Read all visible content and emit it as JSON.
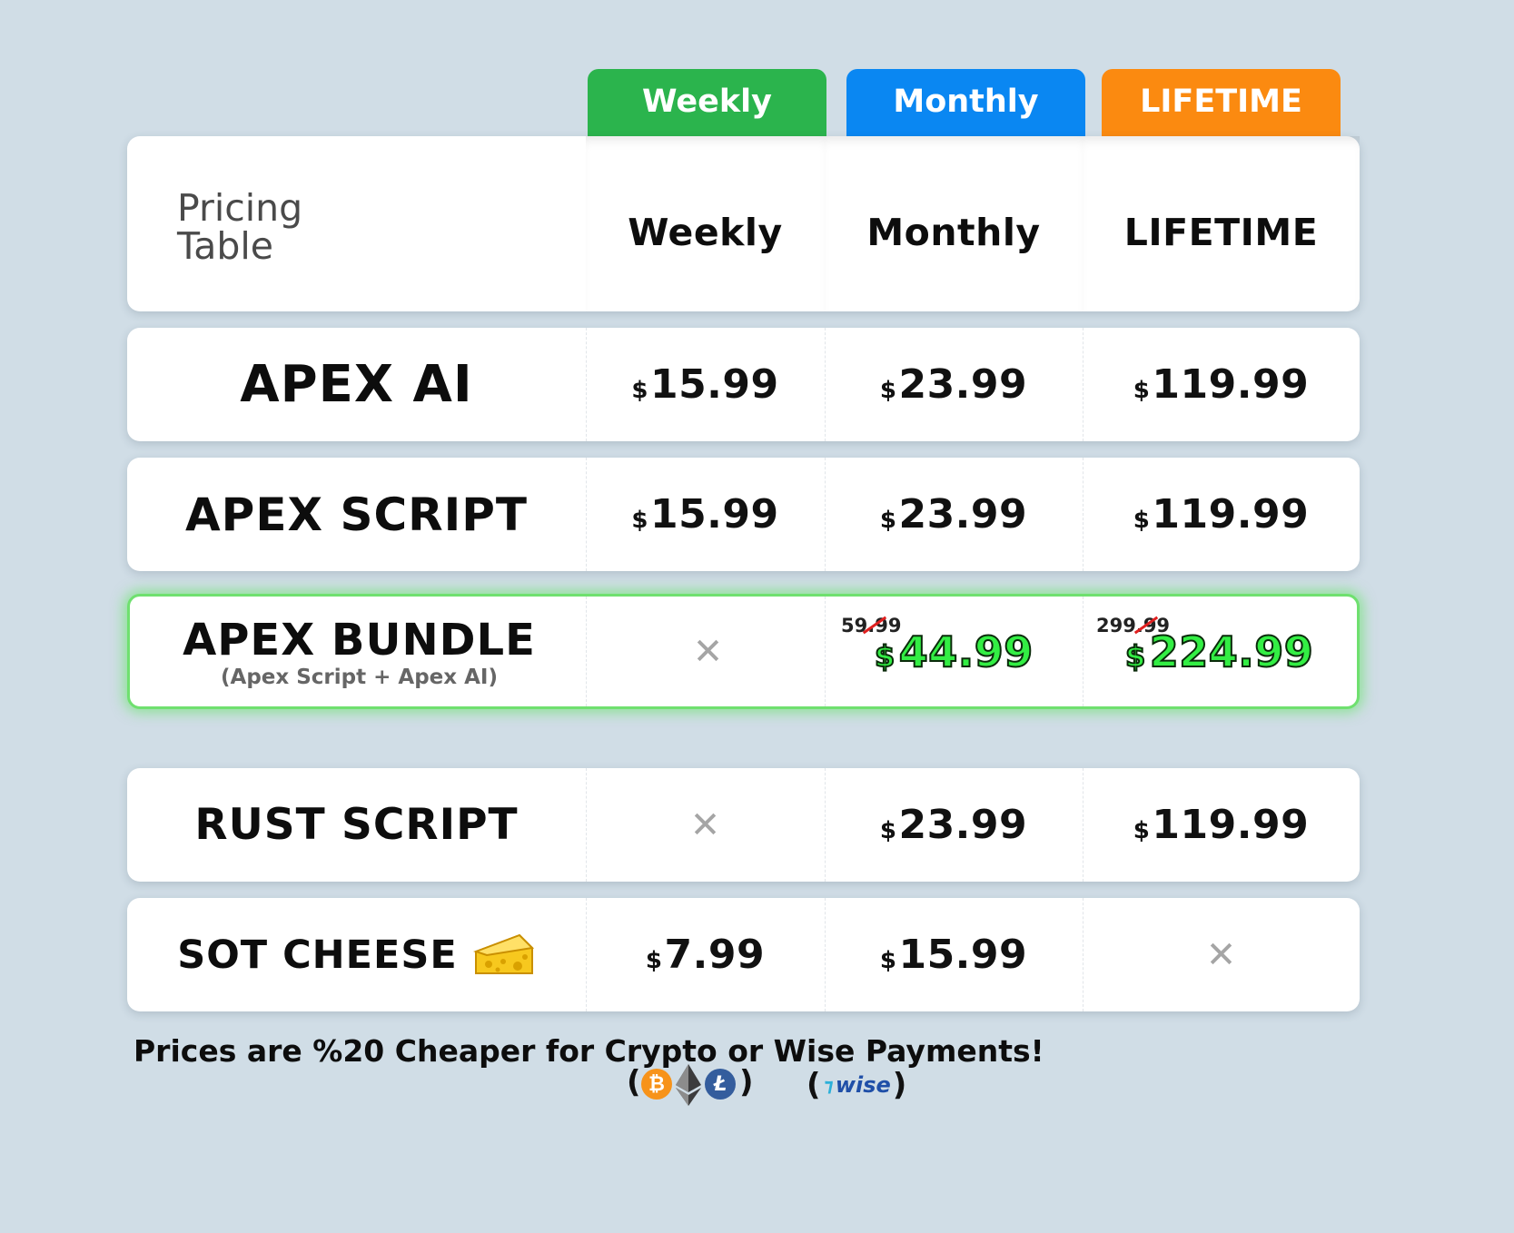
{
  "tabs": {
    "weekly": "Weekly",
    "monthly": "Monthly",
    "lifetime": "LIFETIME"
  },
  "colors": {
    "weekly": "#2bb44d",
    "monthly": "#0a87f2",
    "lifetime": "#fb8a10",
    "highlight_glow": "#5ce85c",
    "discount_green": "#33ee44"
  },
  "header": {
    "title_line1": "Pricing",
    "title_line2": "Table",
    "col_weekly": "Weekly",
    "col_monthly": "Monthly",
    "col_lifetime": "LIFETIME"
  },
  "currency": "$",
  "rows": [
    {
      "name": "APEX AI",
      "weekly": "15.99",
      "monthly": "23.99",
      "lifetime": "119.99"
    },
    {
      "name": "APEX SCRIPT",
      "weekly": "15.99",
      "monthly": "23.99",
      "lifetime": "119.99"
    },
    {
      "name": "APEX BUNDLE",
      "subtitle": "(Apex Script + Apex AI)",
      "weekly": "✕",
      "monthly_old": "59.99",
      "monthly": "44.99",
      "lifetime_old": "299.99",
      "lifetime": "224.99"
    },
    {
      "name": "RUST SCRIPT",
      "weekly": "✕",
      "monthly": "23.99",
      "lifetime": "119.99"
    },
    {
      "name": "SOT CHEESE",
      "icon": "cheese-icon",
      "weekly": "7.99",
      "monthly": "15.99",
      "lifetime": "✕"
    }
  ],
  "footer": {
    "note": "Prices are %20 Cheaper for Crypto or Wise Payments!",
    "crypto_icons": [
      "bitcoin-icon",
      "ethereum-icon",
      "litecoin-icon"
    ],
    "wise_label": "wise",
    "paren_open": "(",
    "paren_close": ")"
  }
}
